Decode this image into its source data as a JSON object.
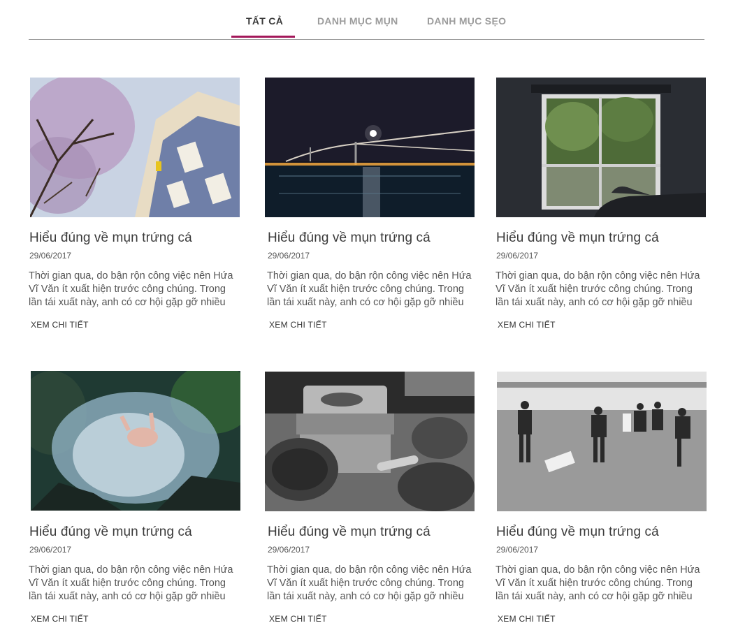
{
  "tabs": [
    {
      "label": "TẤT CẢ",
      "active": true
    },
    {
      "label": "DANH MỤC MỤN",
      "active": false
    },
    {
      "label": "DANH MỤC SẸO",
      "active": false
    }
  ],
  "accent_color": "#a3185a",
  "posts": [
    {
      "image": "building-with-tree",
      "title": "Hiểu đúng về mụn trứng cá",
      "date": "29/06/2017",
      "excerpt": "Thời gian qua, do bận rộn công việc nên Hứa Vĩ Văn ít xuất hiện trước công chúng. Trong lần tái xuất này, anh có cơ hội gặp gỡ nhiều",
      "more": "XEM CHI TIẾT"
    },
    {
      "image": "night-bridge",
      "title": "Hiểu đúng về mụn trứng cá",
      "date": "29/06/2017",
      "excerpt": "Thời gian qua, do bận rộn công việc nên Hứa Vĩ Văn ít xuất hiện trước công chúng. Trong lần tái xuất này, anh có cơ hội gặp gỡ nhiều",
      "more": "XEM CHI TIẾT"
    },
    {
      "image": "window-view",
      "title": "Hiểu đúng về mụn trứng cá",
      "date": "29/06/2017",
      "excerpt": "Thời gian qua, do bận rộn công việc nên Hứa Vĩ Văn ít xuất hiện trước công chúng. Trong lần tái xuất này, anh có cơ hội gặp gỡ nhiều",
      "more": "XEM CHI TIẾT"
    },
    {
      "image": "waterfall-person",
      "title": "Hiểu đúng về mụn trứng cá",
      "date": "29/06/2017",
      "excerpt": "Thời gian qua, do bận rộn công việc nên Hứa Vĩ Văn ít xuất hiện trước công chúng. Trong lần tái xuất này, anh có cơ hội gặp gỡ nhiều",
      "more": "XEM CHI TIẾT"
    },
    {
      "image": "kitchen-pots",
      "title": "Hiểu đúng về mụn trứng cá",
      "date": "29/06/2017",
      "excerpt": "Thời gian qua, do bận rộn công việc nên Hứa Vĩ Văn ít xuất hiện trước công chúng. Trong lần tái xuất này, anh có cơ hội gặp gỡ nhiều",
      "more": "XEM CHI TIẾT"
    },
    {
      "image": "rugby-match",
      "title": "Hiểu đúng về mụn trứng cá",
      "date": "29/06/2017",
      "excerpt": "Thời gian qua, do bận rộn công việc nên Hứa Vĩ Văn ít xuất hiện trước công chúng. Trong lần tái xuất này, anh có cơ hội gặp gỡ nhiều",
      "more": "XEM CHI TIẾT"
    }
  ]
}
